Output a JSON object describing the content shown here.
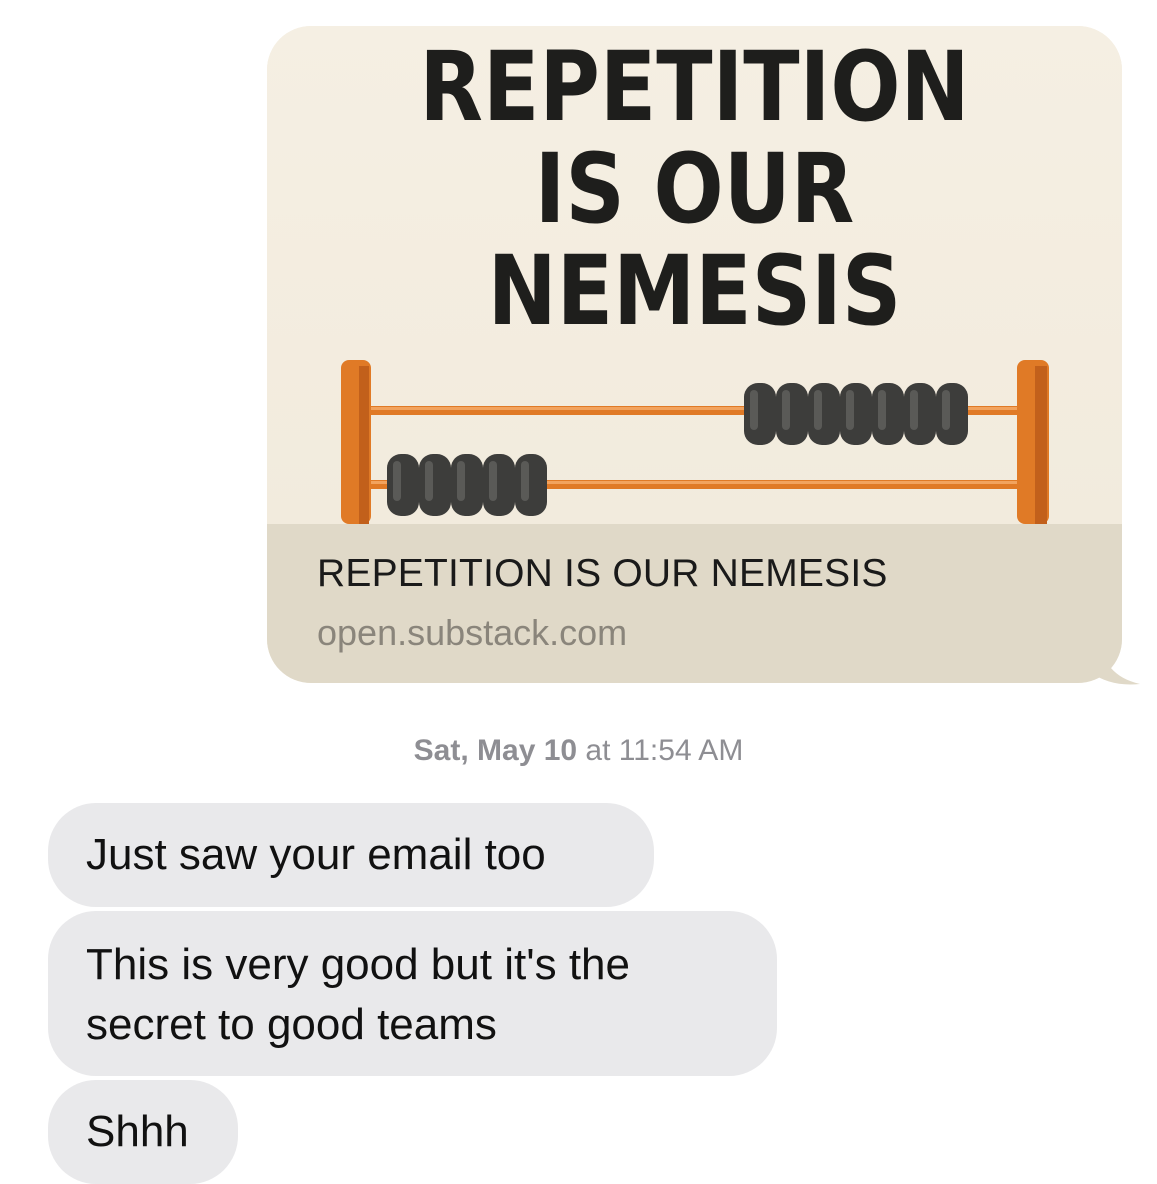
{
  "link_preview": {
    "image_headline_lines": [
      "REPETITION",
      "IS OUR",
      "NEMESIS"
    ],
    "title": "REPETITION IS OUR NEMESIS",
    "domain": "open.substack.com"
  },
  "timestamp": {
    "day": "Sat, May 10",
    "rest": " at 11:54 AM"
  },
  "incoming_messages": [
    {
      "text": "Just saw your email too"
    },
    {
      "line1": "This is very good but it's the",
      "line2": "secret to good teams"
    },
    {
      "text": "Shhh"
    }
  ],
  "colors": {
    "incoming_bubble": "#e9e9eb",
    "preview_background": "#f3ecdf",
    "preview_footer": "#e0d9c8",
    "abacus_frame": "#e07a26",
    "abacus_bead": "#3d3d3b",
    "timestamp_text": "#8e8e93"
  },
  "icons": {
    "abacus": "abacus-illustration"
  }
}
